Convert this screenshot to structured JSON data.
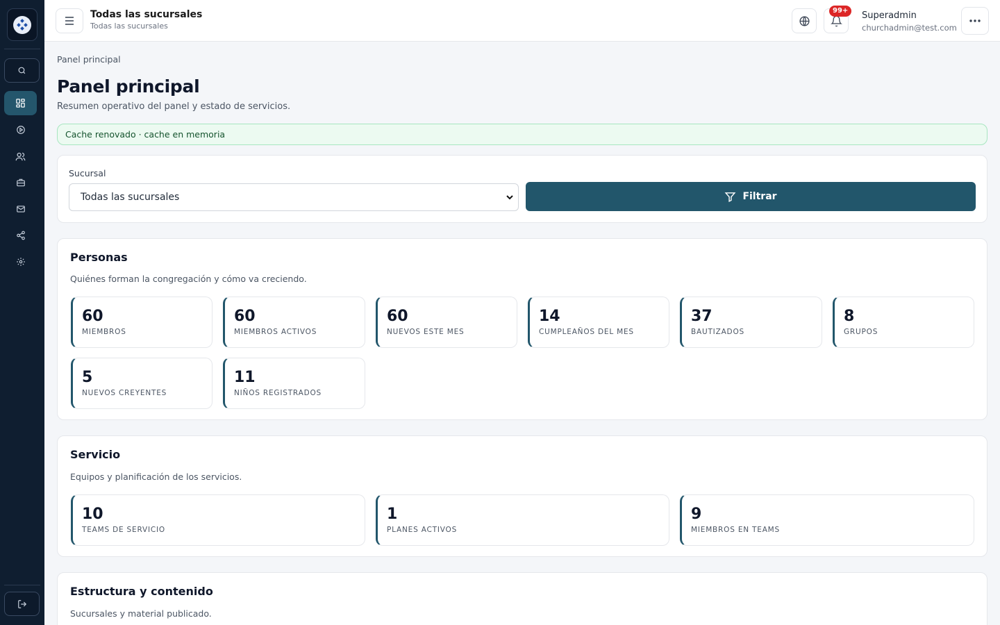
{
  "header": {
    "title": "Todas las sucursales",
    "subtitle": "Todas las sucursales",
    "notification_badge": "99+",
    "user_name": "Superadmin",
    "user_email": "churchadmin@test.com"
  },
  "sidebar": {
    "items": [
      {
        "icon": "dashboard-icon",
        "active": true
      },
      {
        "icon": "play-circle-icon"
      },
      {
        "icon": "users-icon"
      },
      {
        "icon": "briefcase-icon"
      },
      {
        "icon": "mail-icon"
      },
      {
        "icon": "share-icon"
      },
      {
        "icon": "settings-icon"
      }
    ]
  },
  "main": {
    "breadcrumb": "Panel principal",
    "title": "Panel principal",
    "subtitle": "Resumen operativo del panel y estado de servicios.",
    "alert": "Cache renovado · cache en memoria"
  },
  "filter": {
    "label": "Sucursal",
    "selected": "Todas las sucursales",
    "button": "Filtrar"
  },
  "sections": {
    "personas": {
      "title": "Personas",
      "subtitle": "Quiénes forman la congregación y cómo va creciendo.",
      "stats": [
        {
          "value": "60",
          "label": "Miembros"
        },
        {
          "value": "60",
          "label": "Miembros activos"
        },
        {
          "value": "60",
          "label": "Nuevos este mes"
        },
        {
          "value": "14",
          "label": "Cumpleaños del mes"
        },
        {
          "value": "37",
          "label": "Bautizados"
        },
        {
          "value": "8",
          "label": "Grupos"
        },
        {
          "value": "5",
          "label": "Nuevos creyentes"
        },
        {
          "value": "11",
          "label": "Niños registrados"
        }
      ]
    },
    "servicio": {
      "title": "Servicio",
      "subtitle": "Equipos y planificación de los servicios.",
      "stats": [
        {
          "value": "10",
          "label": "Teams de servicio"
        },
        {
          "value": "1",
          "label": "Planes activos"
        },
        {
          "value": "9",
          "label": "Miembros en teams"
        }
      ]
    },
    "estructura": {
      "title": "Estructura y contenido",
      "subtitle": "Sucursales y material publicado."
    }
  },
  "colors": {
    "sidebar_bg": "#0f1e30",
    "accent": "#22566b",
    "badge": "#dc2626",
    "alert_bg": "#ecfaf1"
  }
}
